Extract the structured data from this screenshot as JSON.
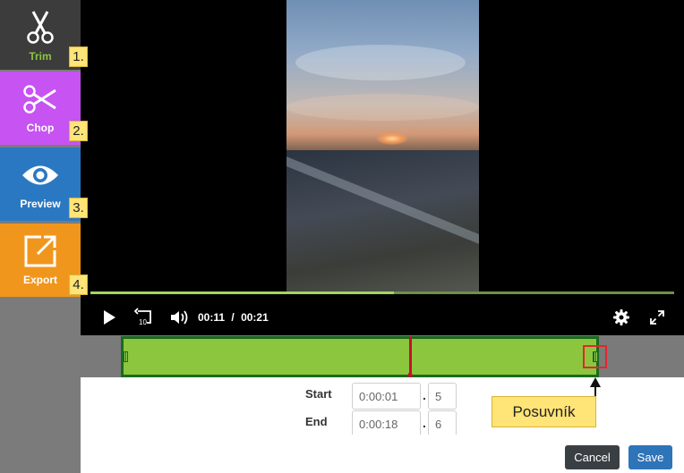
{
  "sidebar": {
    "items": [
      {
        "label": "Trim",
        "icon": "scissors-icon",
        "color": "#3c3c3c",
        "label_color": "#8cc63f",
        "step": "1."
      },
      {
        "label": "Chop",
        "icon": "scissors-icon",
        "color": "#c653f2",
        "step": "2."
      },
      {
        "label": "Preview",
        "icon": "eye-icon",
        "color": "#2b78c2",
        "step": "3."
      },
      {
        "label": "Export",
        "icon": "export-icon",
        "color": "#f1961d",
        "step": "4."
      }
    ]
  },
  "player": {
    "current_time": "00:11",
    "separator": "/",
    "duration": "00:21",
    "progress_fraction": 0.52,
    "controls": [
      "play-icon",
      "rewind-10-icon",
      "volume-icon",
      "settings-icon",
      "fullscreen-icon"
    ],
    "replay_badge": "10"
  },
  "timeline": {
    "fill_color": "#8cc63f",
    "border_color": "#1b6a1f",
    "playhead_color": "#c8102e"
  },
  "fields": {
    "start_label": "Start",
    "start_time": "0:00:01",
    "start_fraction": "5",
    "end_label": "End",
    "end_time": "0:00:18",
    "end_fraction": "6",
    "decimal_separator": "."
  },
  "buttons": {
    "cancel": "Cancel",
    "save": "Save"
  },
  "annotation": {
    "callout": "Posuvník"
  }
}
